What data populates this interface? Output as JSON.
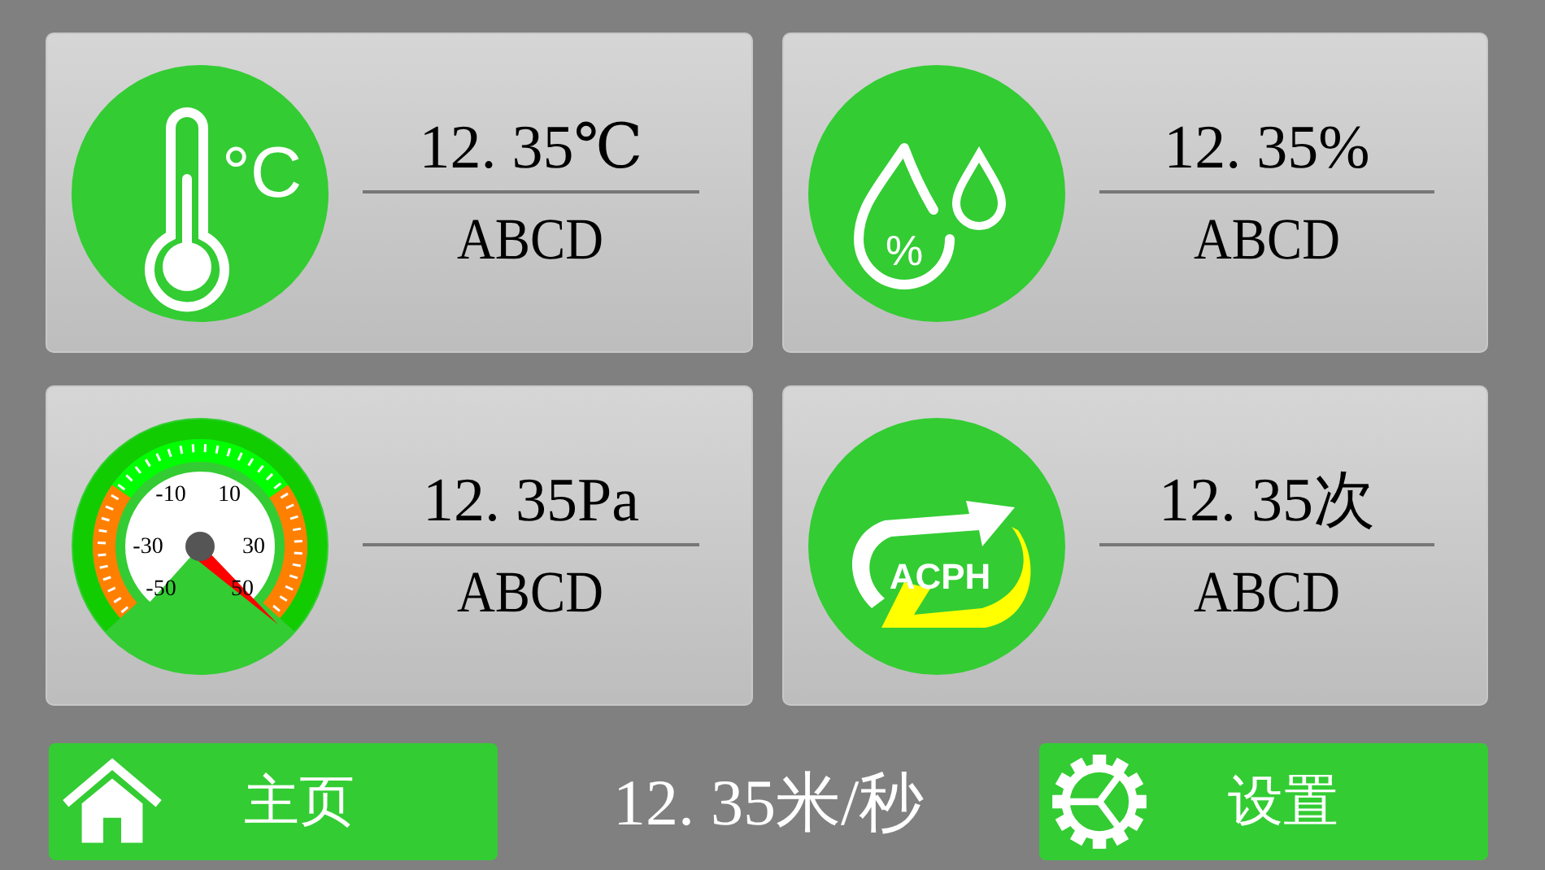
{
  "cards": [
    {
      "kind": "thermometer",
      "icon_text": "°C",
      "value": "12. 35℃",
      "label": "ABCD"
    },
    {
      "kind": "humidity",
      "icon_text": "%",
      "value": "12. 35%",
      "label": "ABCD"
    },
    {
      "kind": "gauge",
      "scale_labels": [
        "-10",
        "10",
        "-30",
        "30",
        "-50",
        "50"
      ],
      "value": "12. 35Pa",
      "label": "ABCD"
    },
    {
      "kind": "acph",
      "icon_text": "ACPH",
      "value": "12. 35次",
      "label": "ABCD"
    }
  ],
  "footer": {
    "home_button": "主页",
    "speed": "12. 35米/秒",
    "settings_button": "设置"
  }
}
